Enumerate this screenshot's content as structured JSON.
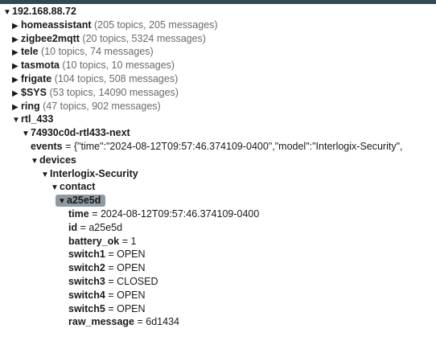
{
  "root": {
    "name": "192.168.88.72"
  },
  "topics": [
    {
      "name": "homeassistant",
      "meta": "(205 topics, 205 messages)"
    },
    {
      "name": "zigbee2mqtt",
      "meta": "(20 topics, 5324 messages)"
    },
    {
      "name": "tele",
      "meta": "(10 topics, 74 messages)"
    },
    {
      "name": "tasmota",
      "meta": "(10 topics, 10 messages)"
    },
    {
      "name": "frigate",
      "meta": "(104 topics, 508 messages)"
    },
    {
      "name": "$SYS",
      "meta": "(53 topics, 14090 messages)"
    },
    {
      "name": "ring",
      "meta": "(47 topics, 902 messages)"
    }
  ],
  "rtl": {
    "name": "rtl_433",
    "device_node": "74930c0d-rtl433-next",
    "events_key": "events",
    "events_value": " = {\"time\":\"2024-08-12T09:57:46.374109-0400\",\"model\":\"Interlogix-Security\",",
    "devices": "devices",
    "model": "Interlogix-Security",
    "contact": "contact",
    "selected_id": "a25e5d",
    "fields": [
      {
        "key": "time",
        "value": " = 2024-08-12T09:57:46.374109-0400"
      },
      {
        "key": "id",
        "value": " = a25e5d"
      },
      {
        "key": "battery_ok",
        "value": " = 1"
      },
      {
        "key": "switch1",
        "value": " = OPEN"
      },
      {
        "key": "switch2",
        "value": " = OPEN"
      },
      {
        "key": "switch3",
        "value": " = CLOSED"
      },
      {
        "key": "switch4",
        "value": " = OPEN"
      },
      {
        "key": "switch5",
        "value": " = OPEN"
      },
      {
        "key": "raw_message",
        "value": " = 6d1434"
      }
    ]
  },
  "icons": {
    "expanded": "triangle-down-icon",
    "collapsed": "triangle-right-icon"
  }
}
